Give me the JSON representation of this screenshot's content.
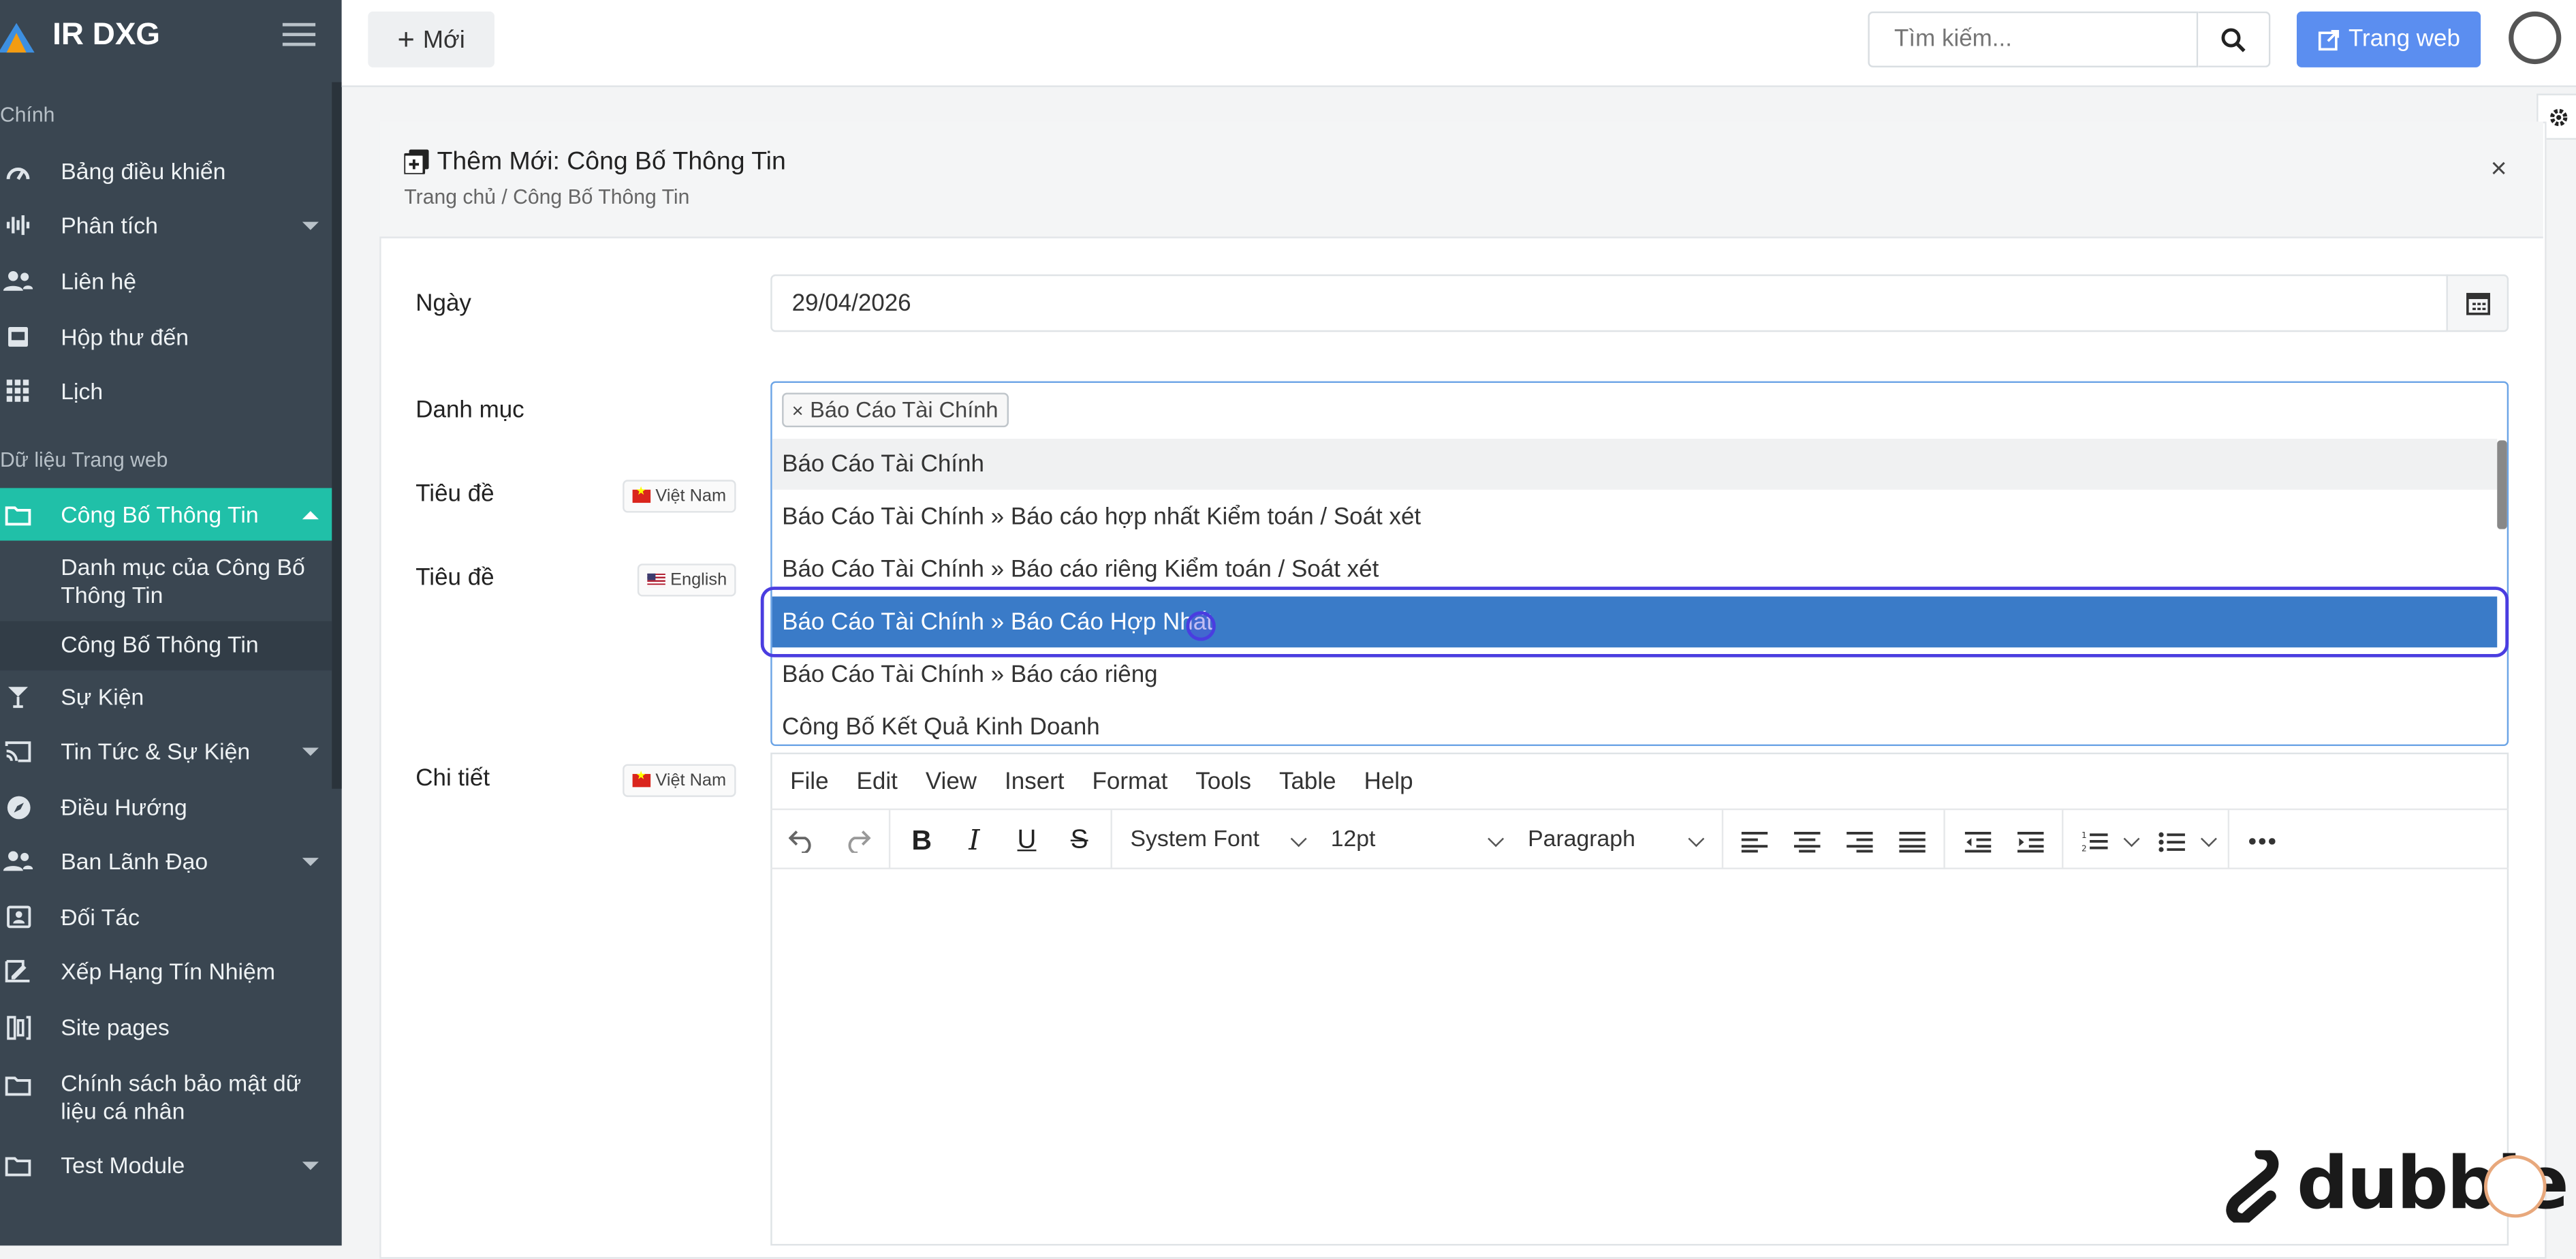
{
  "app": {
    "name": "IR DXG"
  },
  "sidebar": {
    "sections": [
      {
        "label": "Chính"
      },
      {
        "label": "Dữ liệu Trang web"
      }
    ],
    "items": [
      {
        "label": "Bảng điều khiển",
        "icon": "gauge-icon"
      },
      {
        "label": "Phân tích",
        "icon": "waveform-icon"
      },
      {
        "label": "Liên hệ",
        "icon": "users-icon"
      },
      {
        "label": "Hộp thư đến",
        "icon": "inbox-icon"
      },
      {
        "label": "Lịch",
        "icon": "grid-icon"
      },
      {
        "label": "Công Bố Thông Tin",
        "icon": "folder-icon"
      },
      {
        "label": "Sự Kiện",
        "icon": "cocktail-icon"
      },
      {
        "label": "Tin Tức & Sự Kiện",
        "icon": "cast-icon"
      },
      {
        "label": "Điều Hướng",
        "icon": "compass-icon"
      },
      {
        "label": "Ban Lãnh Đạo",
        "icon": "users-icon"
      },
      {
        "label": "Đối Tác",
        "icon": "contact-card-icon"
      },
      {
        "label": "Xếp Hạng Tín Nhiệm",
        "icon": "signature-icon"
      },
      {
        "label": "Site pages",
        "icon": "columns-icon"
      },
      {
        "label": "Chính sách bảo mật dữ liệu cá nhân",
        "icon": "folder-icon"
      },
      {
        "label": "Test Module",
        "icon": "folder-icon"
      }
    ],
    "subitems": [
      {
        "label": "Danh mục của Công Bố Thông Tin"
      },
      {
        "label": "Công Bố Thông Tin"
      }
    ]
  },
  "topbar": {
    "new_label": "Mới",
    "search_placeholder": "Tìm kiếm...",
    "web_label": "Trang web"
  },
  "card": {
    "title": "Thêm Mới: Công Bố Thông Tin",
    "breadcrumb": "Trang chủ / Công Bố Thông Tin",
    "close": "×"
  },
  "form": {
    "date_label": "Ngày",
    "date_value": "29/04/2026",
    "category_label": "Danh mục",
    "selected_tag": "Báo Cáo Tài Chính",
    "title_label": "Tiêu đề",
    "detail_label": "Chi tiết",
    "lang_vn": "Việt Nam",
    "lang_en": "English",
    "options": [
      "Báo Cáo Tài Chính",
      "Báo Cáo Tài Chính » Báo cáo hợp nhất Kiểm toán / Soát xét",
      "Báo Cáo Tài Chính » Báo cáo riêng Kiểm toán / Soát xét",
      "Báo Cáo Tài Chính » Báo Cáo Hợp Nhất",
      "Báo Cáo Tài Chính » Báo cáo riêng",
      "Công Bố Kết Quả Kinh Doanh"
    ]
  },
  "editor": {
    "menus": [
      "File",
      "Edit",
      "View",
      "Insert",
      "Format",
      "Tools",
      "Table",
      "Help"
    ],
    "font": "System Font",
    "size": "12pt",
    "block": "Paragraph"
  },
  "watermark": {
    "text": "dubble"
  }
}
